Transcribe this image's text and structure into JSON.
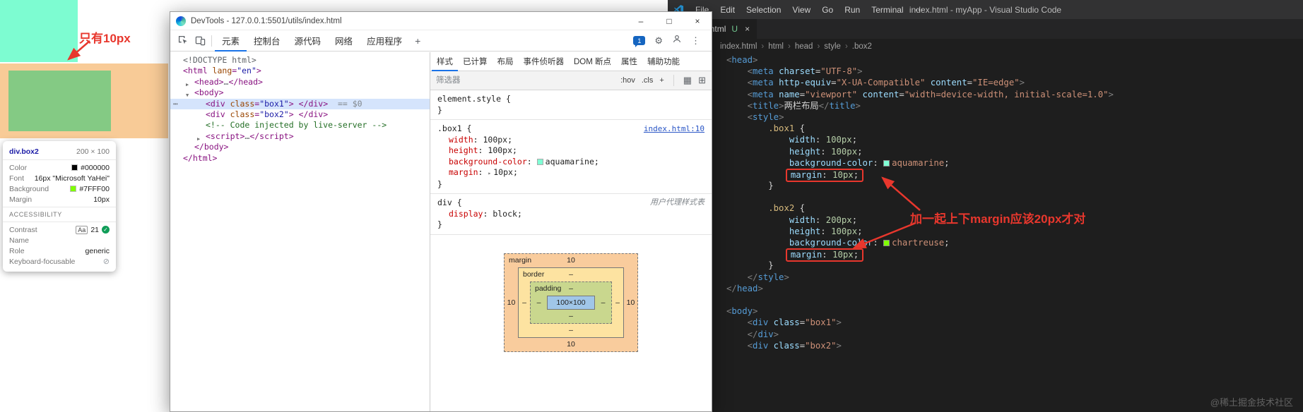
{
  "preview": {
    "annotation": "只有10px",
    "box1_color": "#7dfcd1",
    "overlay_color": "#f8cb97",
    "box2_color": "#84ca84",
    "tooltip": {
      "element_tag": "div",
      "element_class": ".box2",
      "dimensions": "200 × 100",
      "rows": [
        {
          "label": "Color",
          "value": "#000000",
          "swatch": "#000000"
        },
        {
          "label": "Font",
          "value": "16px \"Microsoft YaHei\"",
          "swatch": ""
        },
        {
          "label": "Background",
          "value": "#7FFF00",
          "swatch": "#7FFF00"
        },
        {
          "label": "Margin",
          "value": "10px",
          "swatch": ""
        }
      ],
      "accessibility_title": "ACCESSIBILITY",
      "contrast": {
        "label": "Contrast",
        "aa": "Aa",
        "value": "21",
        "check": "✓"
      },
      "name_label": "Name",
      "role_label": "Role",
      "role_value": "generic",
      "keyboard_label": "Keyboard-focusable",
      "keyboard_icon": "⊘"
    }
  },
  "devtools": {
    "title": "DevTools - 127.0.0.1:5501/utils/index.html",
    "window_controls": {
      "minimize": "–",
      "maximize": "□",
      "close": "×"
    },
    "tabs": [
      "元素",
      "控制台",
      "源代码",
      "网络",
      "应用程序"
    ],
    "more_tabs": "+",
    "issues_count": "1",
    "icons": {
      "gear": "⚙",
      "kebab": "⋮",
      "grid": "▦",
      "panel": "⊞"
    },
    "tree": [
      {
        "ind": 0,
        "seg": [
          {
            "t": "<!DOCTYPE html>",
            "c": "g"
          }
        ]
      },
      {
        "ind": 0,
        "seg": [
          {
            "t": "<html ",
            "c": "t"
          },
          {
            "t": "lang",
            "c": "a"
          },
          {
            "t": "=",
            "c": "t"
          },
          {
            "t": "\"en\"",
            "c": "v"
          },
          {
            "t": ">",
            "c": "t"
          }
        ]
      },
      {
        "ind": 1,
        "arrow": "▶",
        "seg": [
          {
            "t": "<head>",
            "c": "t"
          },
          {
            "t": "…",
            "c": "g"
          },
          {
            "t": "</head>",
            "c": "t"
          }
        ]
      },
      {
        "ind": 1,
        "arrow": "▼",
        "seg": [
          {
            "t": "<body>",
            "c": "t"
          }
        ]
      },
      {
        "ind": 2,
        "sel": true,
        "dots": "⋯",
        "flag": "== $0",
        "seg": [
          {
            "t": "<div ",
            "c": "t"
          },
          {
            "t": "class",
            "c": "a"
          },
          {
            "t": "=",
            "c": "t"
          },
          {
            "t": "\"box1\"",
            "c": "v"
          },
          {
            "t": "> ",
            "c": "t"
          },
          {
            "t": "</div>",
            "c": "t"
          }
        ]
      },
      {
        "ind": 2,
        "seg": [
          {
            "t": "<div ",
            "c": "t"
          },
          {
            "t": "class",
            "c": "a"
          },
          {
            "t": "=",
            "c": "t"
          },
          {
            "t": "\"box2\"",
            "c": "v"
          },
          {
            "t": "> ",
            "c": "t"
          },
          {
            "t": "</div>",
            "c": "t"
          }
        ]
      },
      {
        "ind": 2,
        "seg": [
          {
            "t": "<!-- Code injected by live-server -->",
            "c": "c"
          }
        ]
      },
      {
        "ind": 2,
        "arrow": "▶",
        "seg": [
          {
            "t": "<script>",
            "c": "t"
          },
          {
            "t": "…",
            "c": "g"
          },
          {
            "t": "</script>",
            "c": "t"
          }
        ]
      },
      {
        "ind": 1,
        "seg": [
          {
            "t": "</body>",
            "c": "t"
          }
        ]
      },
      {
        "ind": 0,
        "seg": [
          {
            "t": "</html>",
            "c": "t"
          }
        ]
      }
    ],
    "styles": {
      "tabs": [
        "样式",
        "已计算",
        "布局",
        "事件侦听器",
        "DOM 断点",
        "属性",
        "辅助功能"
      ],
      "filter_placeholder": "筛选器",
      "state_buttons": [
        ":hov",
        ".cls",
        "+"
      ],
      "rules": [
        {
          "selector": "element.style",
          "props": []
        },
        {
          "selector": ".box1",
          "link": "index.html:10",
          "props": [
            {
              "name": "width",
              "value": "100px"
            },
            {
              "name": "height",
              "value": "100px"
            },
            {
              "name": "background-color",
              "value": "aquamarine",
              "swatch": "#7fffd4"
            },
            {
              "name": "margin",
              "value": "10px",
              "arrow": "▸"
            }
          ]
        },
        {
          "selector": "div",
          "origin": "用户代理样式表",
          "props": [
            {
              "name": "display",
              "value": "block"
            }
          ]
        }
      ],
      "box_model": {
        "margin_label": "margin",
        "border_label": "border",
        "padding_label": "padding",
        "margin_value": "10",
        "border_value": "–",
        "padding_value": "–",
        "content": "100×100"
      }
    }
  },
  "vscode": {
    "menu": [
      "File",
      "Edit",
      "Selection",
      "View",
      "Go",
      "Run",
      "Terminal",
      "⋯"
    ],
    "window_title": "index.html - myApp - Visual Studio Code",
    "tab": {
      "icon": "<>",
      "name": "index.html",
      "git_status": "U",
      "close": "×"
    },
    "breadcrumbs": [
      "index.html",
      "html",
      "head",
      "style",
      ".box2"
    ],
    "code_lines": [
      {
        "seg": [
          {
            "t": "<",
            "c": "p"
          },
          {
            "t": "head",
            "c": "t"
          },
          {
            "t": ">",
            "c": "p"
          }
        ]
      },
      {
        "seg": [
          {
            "t": "    ",
            "c": "w"
          },
          {
            "t": "<",
            "c": "p"
          },
          {
            "t": "meta",
            "c": "t"
          },
          {
            "t": " ",
            "c": "w"
          },
          {
            "t": "charset",
            "c": "a"
          },
          {
            "t": "=",
            "c": "w"
          },
          {
            "t": "\"UTF-8\"",
            "c": "s"
          },
          {
            "t": ">",
            "c": "p"
          }
        ]
      },
      {
        "seg": [
          {
            "t": "    ",
            "c": "w"
          },
          {
            "t": "<",
            "c": "p"
          },
          {
            "t": "meta",
            "c": "t"
          },
          {
            "t": " ",
            "c": "w"
          },
          {
            "t": "http-equiv",
            "c": "a"
          },
          {
            "t": "=",
            "c": "w"
          },
          {
            "t": "\"X-UA-Compatible\"",
            "c": "s"
          },
          {
            "t": " ",
            "c": "w"
          },
          {
            "t": "content",
            "c": "a"
          },
          {
            "t": "=",
            "c": "w"
          },
          {
            "t": "\"IE=edge\"",
            "c": "s"
          },
          {
            "t": ">",
            "c": "p"
          }
        ]
      },
      {
        "seg": [
          {
            "t": "    ",
            "c": "w"
          },
          {
            "t": "<",
            "c": "p"
          },
          {
            "t": "meta",
            "c": "t"
          },
          {
            "t": " ",
            "c": "w"
          },
          {
            "t": "name",
            "c": "a"
          },
          {
            "t": "=",
            "c": "w"
          },
          {
            "t": "\"viewport\"",
            "c": "s"
          },
          {
            "t": " ",
            "c": "w"
          },
          {
            "t": "content",
            "c": "a"
          },
          {
            "t": "=",
            "c": "w"
          },
          {
            "t": "\"width=device-width, initial-scale=1.0\"",
            "c": "s"
          },
          {
            "t": ">",
            "c": "p"
          }
        ]
      },
      {
        "seg": [
          {
            "t": "    ",
            "c": "w"
          },
          {
            "t": "<",
            "c": "p"
          },
          {
            "t": "title",
            "c": "t"
          },
          {
            "t": ">",
            "c": "p"
          },
          {
            "t": "两栏布局",
            "c": "w"
          },
          {
            "t": "</",
            "c": "p"
          },
          {
            "t": "title",
            "c": "t"
          },
          {
            "t": ">",
            "c": "p"
          }
        ]
      },
      {
        "seg": [
          {
            "t": "    ",
            "c": "w"
          },
          {
            "t": "<",
            "c": "p"
          },
          {
            "t": "style",
            "c": "t"
          },
          {
            "t": ">",
            "c": "p"
          }
        ]
      },
      {
        "seg": [
          {
            "t": "        ",
            "c": "w"
          },
          {
            "t": ".box1",
            "c": "sel"
          },
          {
            "t": " {",
            "c": "w"
          }
        ]
      },
      {
        "seg": [
          {
            "t": "            ",
            "c": "w"
          },
          {
            "t": "width",
            "c": "pr"
          },
          {
            "t": ": ",
            "c": "w"
          },
          {
            "t": "100px",
            "c": "n"
          },
          {
            "t": ";",
            "c": "w"
          }
        ]
      },
      {
        "seg": [
          {
            "t": "            ",
            "c": "w"
          },
          {
            "t": "height",
            "c": "pr"
          },
          {
            "t": ": ",
            "c": "w"
          },
          {
            "t": "100px",
            "c": "n"
          },
          {
            "t": ";",
            "c": "w"
          }
        ]
      },
      {
        "seg": [
          {
            "t": "            ",
            "c": "w"
          },
          {
            "t": "background-color",
            "c": "pr"
          },
          {
            "t": ": ",
            "c": "w"
          },
          {
            "sw": "#7fffd4"
          },
          {
            "t": "aquamarine",
            "c": "kw"
          },
          {
            "t": ";",
            "c": "w"
          }
        ]
      },
      {
        "lead": "            ",
        "box": true,
        "seg": [
          {
            "t": "margin",
            "c": "pr"
          },
          {
            "t": ": ",
            "c": "w"
          },
          {
            "t": "10px",
            "c": "n"
          },
          {
            "t": ";",
            "c": "w"
          }
        ]
      },
      {
        "seg": [
          {
            "t": "        }",
            "c": "w"
          }
        ]
      },
      {
        "seg": []
      },
      {
        "seg": [
          {
            "t": "        ",
            "c": "w"
          },
          {
            "t": ".box2",
            "c": "sel"
          },
          {
            "t": " {",
            "c": "w"
          }
        ]
      },
      {
        "seg": [
          {
            "t": "            ",
            "c": "w"
          },
          {
            "t": "width",
            "c": "pr"
          },
          {
            "t": ": ",
            "c": "w"
          },
          {
            "t": "200px",
            "c": "n"
          },
          {
            "t": ";",
            "c": "w"
          }
        ]
      },
      {
        "seg": [
          {
            "t": "            ",
            "c": "w"
          },
          {
            "t": "height",
            "c": "pr"
          },
          {
            "t": ": ",
            "c": "w"
          },
          {
            "t": "100px",
            "c": "n"
          },
          {
            "t": ";",
            "c": "w"
          }
        ]
      },
      {
        "seg": [
          {
            "t": "            ",
            "c": "w"
          },
          {
            "t": "background-color",
            "c": "pr"
          },
          {
            "t": ": ",
            "c": "w"
          },
          {
            "sw": "#7fff00"
          },
          {
            "t": "chartreuse",
            "c": "kw"
          },
          {
            "t": ";",
            "c": "w"
          }
        ]
      },
      {
        "lead": "            ",
        "box": true,
        "seg": [
          {
            "t": "margin",
            "c": "pr"
          },
          {
            "t": ": ",
            "c": "w"
          },
          {
            "t": "10px",
            "c": "n"
          },
          {
            "t": ";",
            "c": "w"
          }
        ]
      },
      {
        "seg": [
          {
            "t": "        }",
            "c": "w"
          }
        ]
      },
      {
        "seg": [
          {
            "t": "    ",
            "c": "w"
          },
          {
            "t": "</",
            "c": "p"
          },
          {
            "t": "style",
            "c": "t"
          },
          {
            "t": ">",
            "c": "p"
          }
        ]
      },
      {
        "seg": [
          {
            "t": "</",
            "c": "p"
          },
          {
            "t": "head",
            "c": "t"
          },
          {
            "t": ">",
            "c": "p"
          }
        ]
      },
      {
        "seg": []
      },
      {
        "seg": [
          {
            "t": "<",
            "c": "p"
          },
          {
            "t": "body",
            "c": "t"
          },
          {
            "t": ">",
            "c": "p"
          }
        ]
      },
      {
        "seg": [
          {
            "t": "    ",
            "c": "w"
          },
          {
            "t": "<",
            "c": "p"
          },
          {
            "t": "div",
            "c": "t"
          },
          {
            "t": " ",
            "c": "w"
          },
          {
            "t": "class",
            "c": "a"
          },
          {
            "t": "=",
            "c": "w"
          },
          {
            "t": "\"box1\"",
            "c": "s"
          },
          {
            "t": ">",
            "c": "p"
          }
        ]
      },
      {
        "seg": [
          {
            "t": "    ",
            "c": "w"
          },
          {
            "t": "</",
            "c": "p"
          },
          {
            "t": "div",
            "c": "t"
          },
          {
            "t": ">",
            "c": "p"
          }
        ]
      },
      {
        "seg": [
          {
            "t": "    ",
            "c": "w"
          },
          {
            "t": "<",
            "c": "p"
          },
          {
            "t": "div",
            "c": "t"
          },
          {
            "t": " ",
            "c": "w"
          },
          {
            "t": "class",
            "c": "a"
          },
          {
            "t": "=",
            "c": "w"
          },
          {
            "t": "\"box2\"",
            "c": "s"
          },
          {
            "t": ">",
            "c": "p"
          }
        ]
      }
    ],
    "annotation": "加一起上下margin应该20px才对",
    "watermark": "@稀土掘金技术社区"
  }
}
